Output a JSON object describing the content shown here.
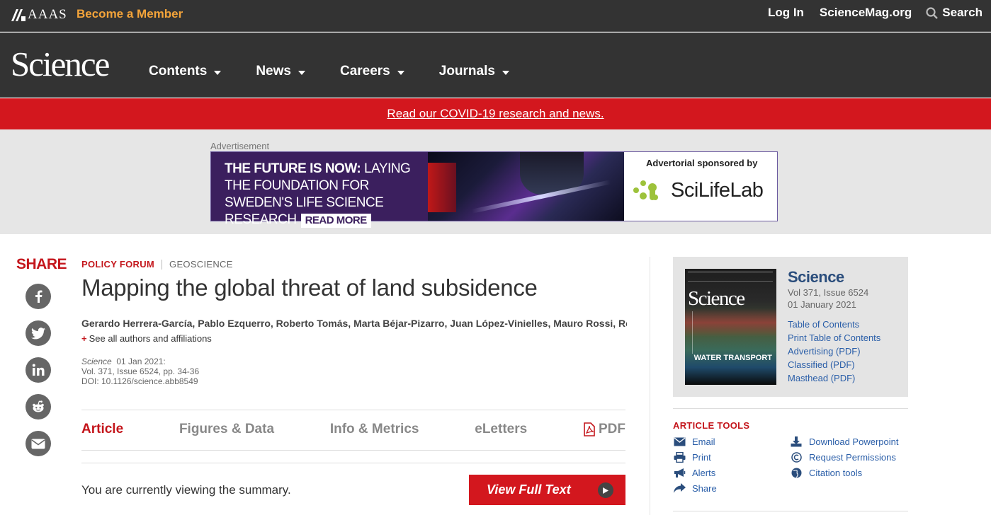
{
  "topbar": {
    "brand": "AAAS",
    "become_member": "Become a Member",
    "login": "Log In",
    "sciencemag": "ScienceMag.org",
    "search": "Search"
  },
  "nav": {
    "logo": "Science",
    "items": [
      "Contents",
      "News",
      "Careers",
      "Journals"
    ]
  },
  "covid_banner": "Read our COVID-19 research and news.",
  "ad": {
    "label": "Advertisement",
    "headline_bold": "THE FUTURE IS NOW:",
    "headline_rest": " LAYING THE FOUNDATION FOR SWEDEN'S LIFE SCIENCE RESEARCH",
    "read_more": "READ MORE",
    "sponsor_text": "Advertorial sponsored by",
    "sponsor_name": "SciLifeLab"
  },
  "share": {
    "title": "SHARE",
    "icons": [
      "facebook-icon",
      "twitter-icon",
      "linkedin-icon",
      "reddit-icon",
      "email-icon"
    ]
  },
  "article": {
    "category": "POLICY FORUM",
    "subject": "GEOSCIENCE",
    "title": "Mapping the global threat of land subsidence",
    "authors": "Gerardo Herrera-García, Pablo Ezquerro, Roberto Tomás, Marta Béjar-Pizarro, Juan López-Vinielles, Mauro Rossi, Rosa M. …",
    "see_all": "See all authors and affiliations",
    "journal": "Science",
    "date": "01 Jan 2021:",
    "volume": "Vol. 371, Issue 6524, pp. 34-36",
    "doi": "DOI: 10.1126/science.abb8549",
    "tabs": [
      "Article",
      "Figures & Data",
      "Info & Metrics",
      "eLetters",
      "PDF"
    ],
    "summary_text": "You are currently viewing the summary.",
    "view_full_text": "View Full Text"
  },
  "issue": {
    "name": "Science",
    "volume": "Vol 371, Issue 6524",
    "date": "01 January 2021",
    "cover_title": "Science",
    "cover_headline": "WATER TRANSPORT",
    "links": [
      "Table of Contents",
      "Print Table of Contents",
      "Advertising (PDF)",
      "Classified (PDF)",
      "Masthead (PDF)"
    ]
  },
  "tools": {
    "title": "ARTICLE TOOLS",
    "left": [
      "Email",
      "Print",
      "Alerts",
      "Share"
    ],
    "right": [
      "Download Powerpoint",
      "Request Permissions",
      "Citation tools"
    ]
  },
  "colors": {
    "dark_bar": "#333333",
    "brand_red": "#d3171e",
    "link_blue": "#2a5ea8",
    "orange": "#f2a33a"
  }
}
